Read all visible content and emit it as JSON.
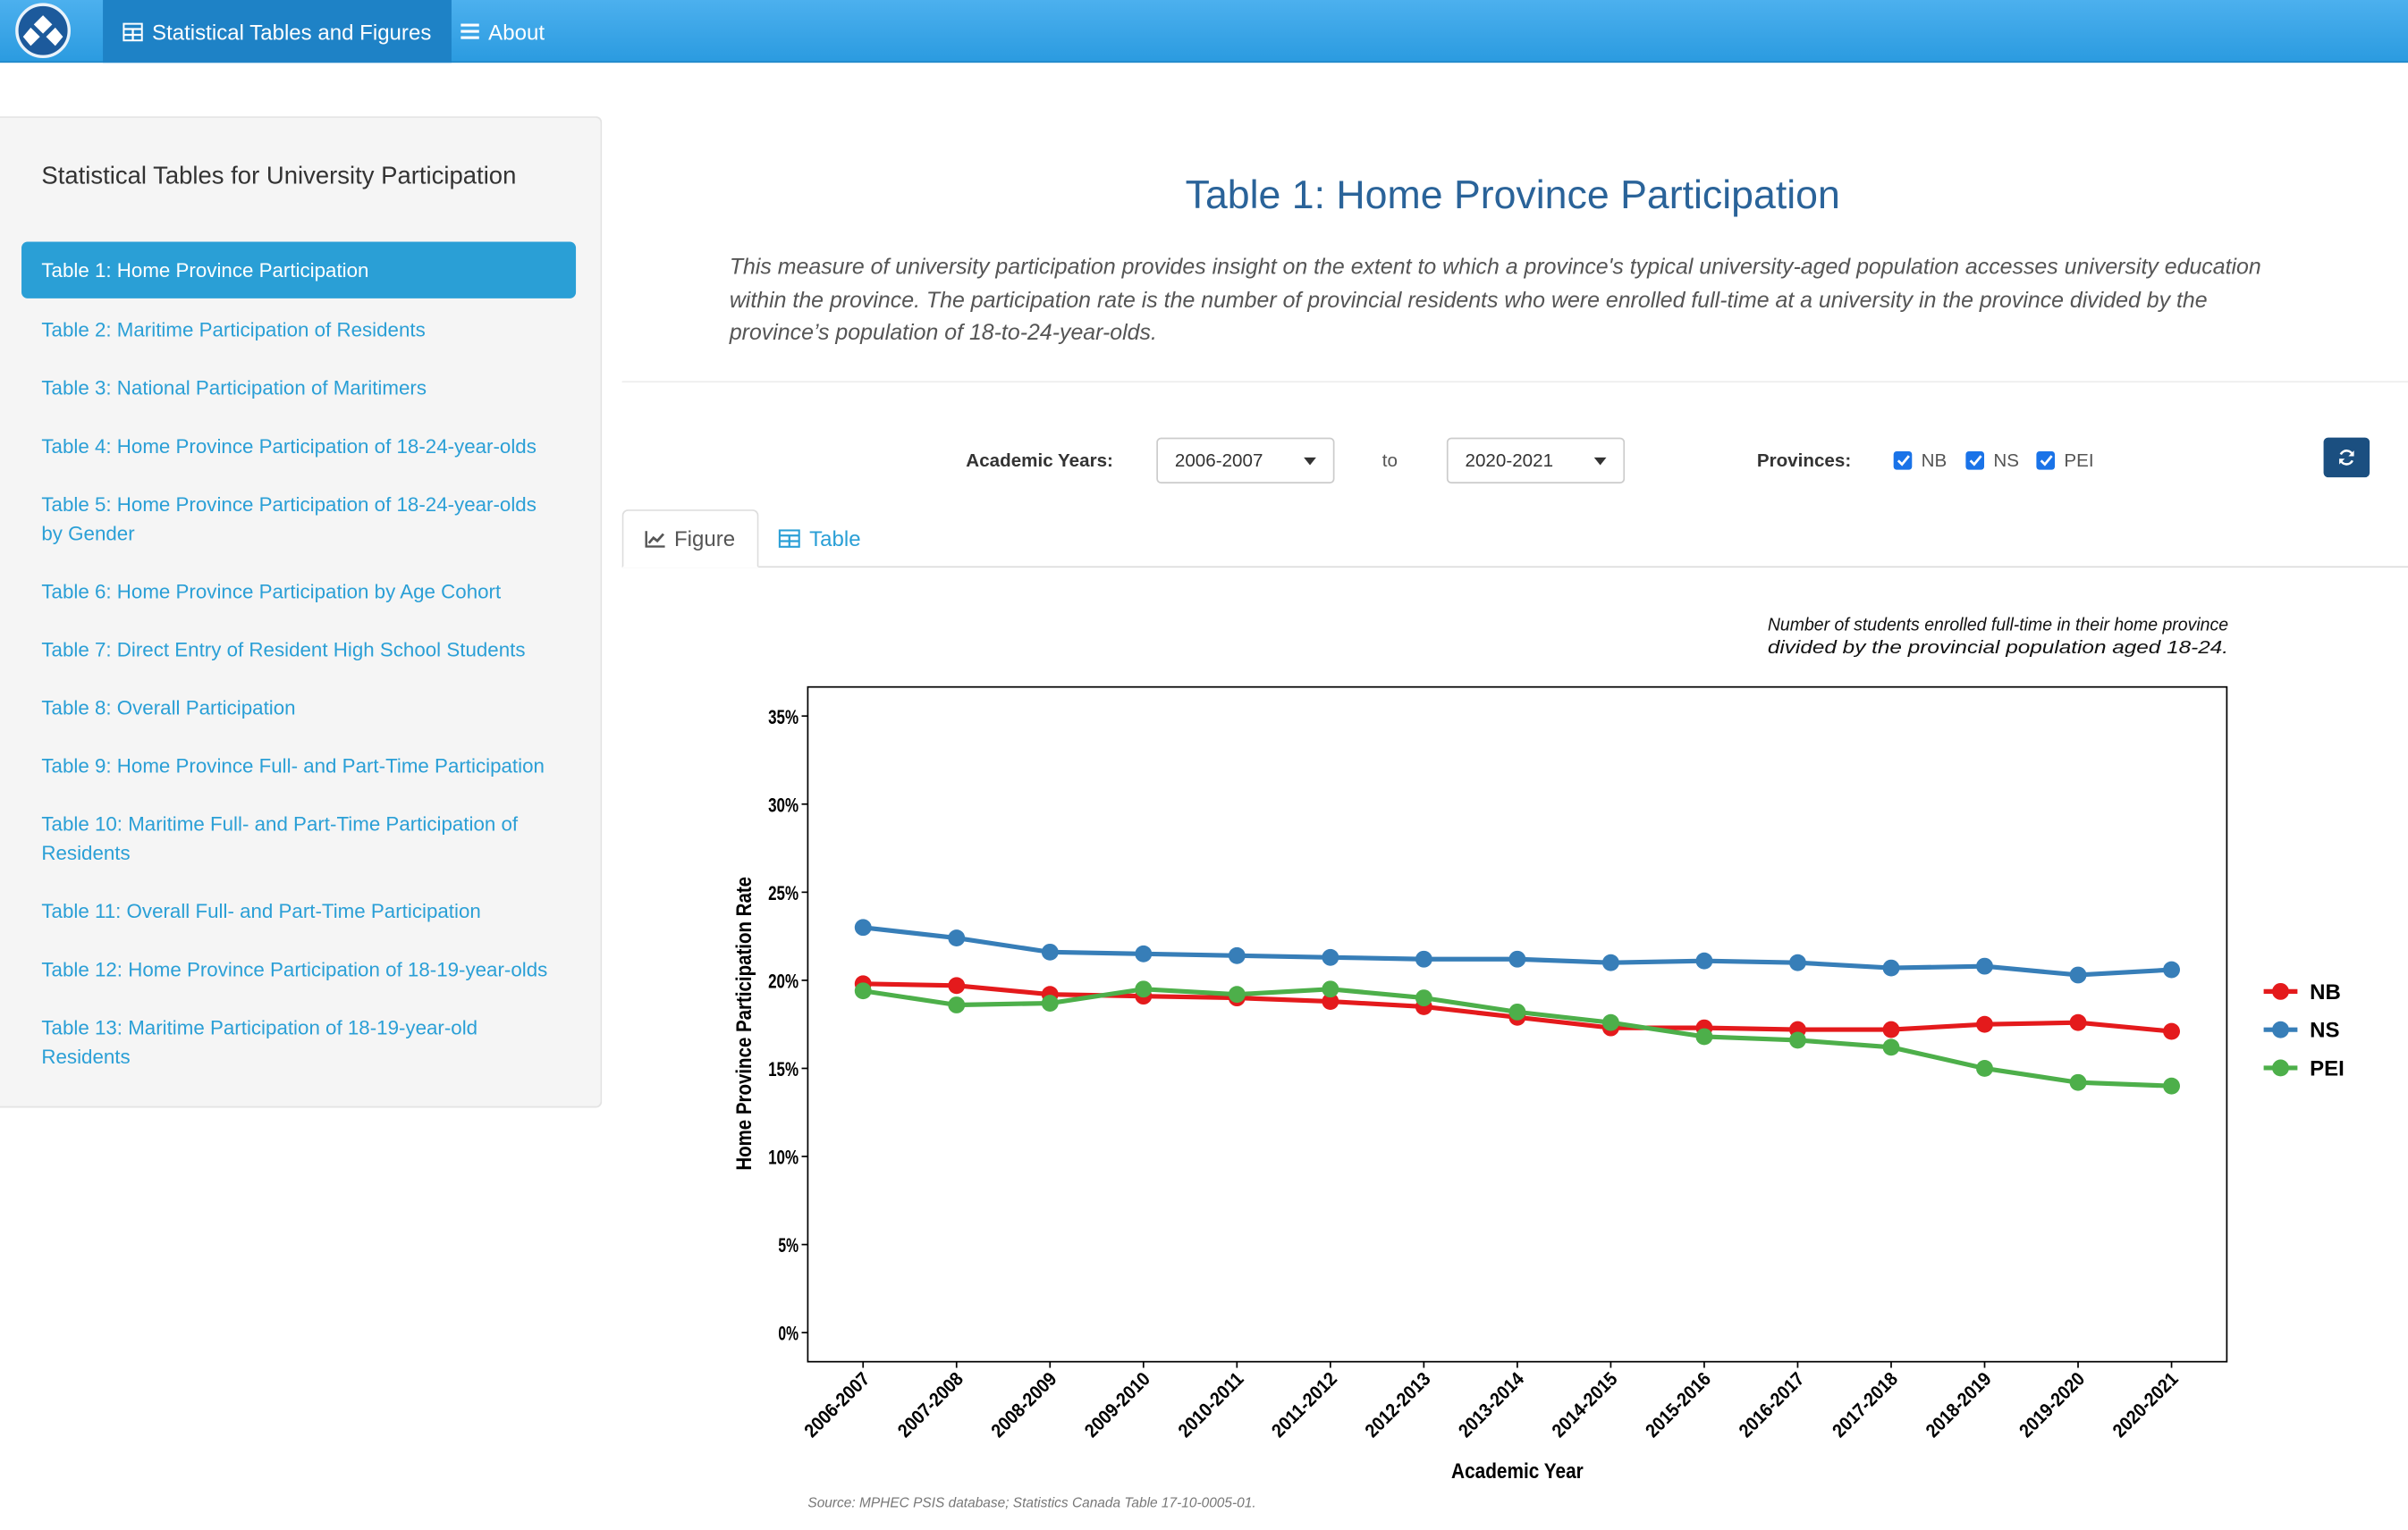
{
  "navbar": {
    "items": [
      {
        "label": "Statistical Tables and Figures",
        "icon": "table-icon",
        "active": true
      },
      {
        "label": "About",
        "icon": "menu-icon",
        "active": false
      }
    ]
  },
  "sidebar": {
    "title": "Statistical Tables for University Participation",
    "items": [
      {
        "label": "Table 1: Home Province Participation",
        "active": true
      },
      {
        "label": "Table 2: Maritime Participation of Residents"
      },
      {
        "label": "Table 3: National Participation of Maritimers"
      },
      {
        "label": "Table 4: Home Province Participation of 18-24-year-olds"
      },
      {
        "label": "Table 5: Home Province Participation of 18-24-year-olds by Gender"
      },
      {
        "label": "Table 6: Home Province Participation by Age Cohort"
      },
      {
        "label": "Table 7: Direct Entry of Resident High School Students"
      },
      {
        "label": "Table 8: Overall Participation"
      },
      {
        "label": "Table 9: Home Province Full- and Part-Time Participation"
      },
      {
        "label": "Table 10: Maritime Full- and Part-Time Participation of Residents"
      },
      {
        "label": "Table 11: Overall Full- and Part-Time Participation"
      },
      {
        "label": "Table 12: Home Province Participation of 18-19-year-olds"
      },
      {
        "label": "Table 13: Maritime Participation of 18-19-year-old Residents"
      }
    ]
  },
  "main": {
    "title": "Table 1: Home Province Participation",
    "description": "This measure of university participation provides insight on the extent to which a province's typical university-aged population accesses university education within the province. The participation rate is the number of provincial residents who were enrolled full-time at a university in the province divided by the province’s population of 18-to-24-year-olds."
  },
  "controls": {
    "academic_years_label": "Academic Years:",
    "from_value": "2006-2007",
    "to_label": "to",
    "to_value": "2020-2021",
    "provinces_label": "Provinces:",
    "provinces": [
      {
        "label": "NB",
        "checked": true
      },
      {
        "label": "NS",
        "checked": true
      },
      {
        "label": "PEI",
        "checked": true
      }
    ],
    "refresh_icon": "refresh-icon"
  },
  "tabs": [
    {
      "label": "Figure",
      "icon": "line-chart-icon",
      "active": true
    },
    {
      "label": "Table",
      "icon": "table-icon",
      "active": false
    }
  ],
  "chart_data": {
    "type": "line",
    "subtitle_lines": [
      "Number of students enrolled full-time in their home province",
      "divided by the provincial population aged 18-24."
    ],
    "xlabel": "Academic Year",
    "ylabel": "Home Province Participation Rate",
    "ylim": [
      0,
      0.35
    ],
    "yticks": [
      "0%",
      "5%",
      "10%",
      "15%",
      "20%",
      "25%",
      "30%",
      "35%"
    ],
    "legend_position": "right",
    "categories": [
      "2006-2007",
      "2007-2008",
      "2008-2009",
      "2009-2010",
      "2010-2011",
      "2011-2012",
      "2012-2013",
      "2013-2014",
      "2014-2015",
      "2015-2016",
      "2016-2017",
      "2017-2018",
      "2018-2019",
      "2019-2020",
      "2020-2021"
    ],
    "series": [
      {
        "name": "NB",
        "color": "#e41a1c",
        "values": [
          0.198,
          0.197,
          0.192,
          0.191,
          0.19,
          0.188,
          0.185,
          0.179,
          0.173,
          0.173,
          0.172,
          0.172,
          0.175,
          0.176,
          0.171
        ]
      },
      {
        "name": "NS",
        "color": "#377eb8",
        "values": [
          0.23,
          0.224,
          0.216,
          0.215,
          0.214,
          0.213,
          0.212,
          0.212,
          0.21,
          0.211,
          0.21,
          0.207,
          0.208,
          0.203,
          0.206
        ]
      },
      {
        "name": "PEI",
        "color": "#4daf4a",
        "values": [
          0.194,
          0.186,
          0.187,
          0.195,
          0.192,
          0.195,
          0.19,
          0.182,
          0.176,
          0.168,
          0.166,
          0.162,
          0.15,
          0.142,
          0.14
        ]
      }
    ],
    "source": "Source: MPHEC PSIS database; Statistics Canada Table 17-10-0005-01."
  }
}
